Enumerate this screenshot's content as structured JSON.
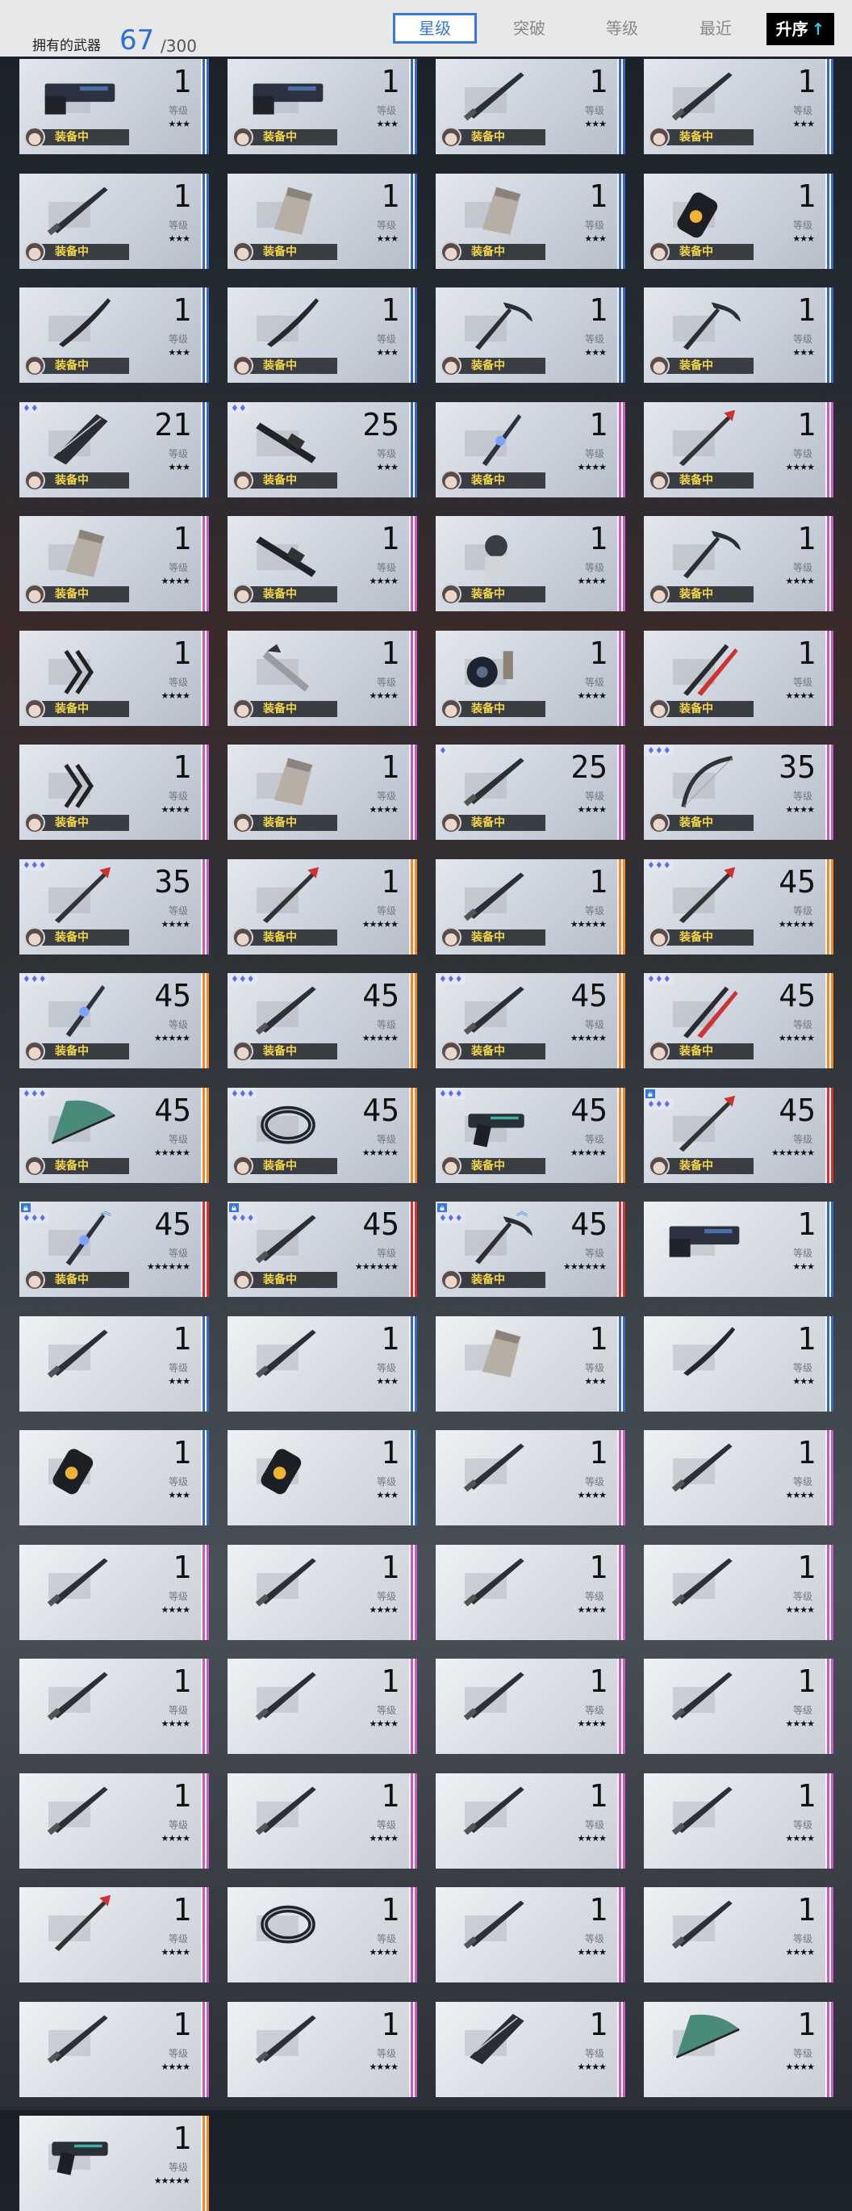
{
  "header": {
    "owned_label": "拥有的武器",
    "owned_count": "67",
    "owned_total": "/300",
    "tabs": [
      {
        "label": "星级",
        "active": true
      },
      {
        "label": "突破",
        "active": false
      },
      {
        "label": "等级",
        "active": false
      },
      {
        "label": "最近",
        "active": false
      }
    ],
    "sort_label": "升序",
    "sort_icon": "arrow-up-icon"
  },
  "common": {
    "level_label": "等级",
    "equipped_label": "装备中"
  },
  "colors": {
    "rarity_3": "#3c68b8",
    "rarity_4": "#c25ec0",
    "rarity_5": "#ee8a2a",
    "rarity_6": "#d83030",
    "accent": "#3a78d8",
    "equipped_text": "#f4d64a"
  },
  "weapons": [
    {
      "level": "1",
      "stars": "★★★",
      "rarity": 3,
      "equipped": true,
      "icon": "blaster-icon"
    },
    {
      "level": "1",
      "stars": "★★★",
      "rarity": 3,
      "equipped": true,
      "icon": "blaster-icon"
    },
    {
      "level": "1",
      "stars": "★★★",
      "rarity": 3,
      "equipped": true,
      "icon": "blade-icon"
    },
    {
      "level": "1",
      "stars": "★★★",
      "rarity": 3,
      "equipped": true,
      "icon": "blade-icon"
    },
    {
      "level": "1",
      "stars": "★★★",
      "rarity": 3,
      "equipped": true,
      "icon": "blade-icon"
    },
    {
      "level": "1",
      "stars": "★★★",
      "rarity": 3,
      "equipped": true,
      "icon": "gauntlet-icon"
    },
    {
      "level": "1",
      "stars": "★★★",
      "rarity": 3,
      "equipped": true,
      "icon": "gauntlet-icon"
    },
    {
      "level": "1",
      "stars": "★★★",
      "rarity": 3,
      "equipped": true,
      "icon": "cannon-icon"
    },
    {
      "level": "1",
      "stars": "★★★",
      "rarity": 3,
      "equipped": true,
      "icon": "katana-icon"
    },
    {
      "level": "1",
      "stars": "★★★",
      "rarity": 3,
      "equipped": true,
      "icon": "katana-icon"
    },
    {
      "level": "1",
      "stars": "★★★",
      "rarity": 3,
      "equipped": true,
      "icon": "scythe-icon"
    },
    {
      "level": "1",
      "stars": "★★★",
      "rarity": 3,
      "equipped": true,
      "icon": "scythe-icon"
    },
    {
      "level": "21",
      "stars": "★★★",
      "rarity": 3,
      "equipped": true,
      "icon": "greatsword-icon",
      "tier": "♦♦"
    },
    {
      "level": "25",
      "stars": "★★★",
      "rarity": 3,
      "equipped": true,
      "icon": "rifle-icon",
      "tier": "♦♦"
    },
    {
      "level": "1",
      "stars": "★★★★",
      "rarity": 4,
      "equipped": true,
      "icon": "lance-icon"
    },
    {
      "level": "1",
      "stars": "★★★★",
      "rarity": 4,
      "equipped": true,
      "icon": "spear-icon"
    },
    {
      "level": "1",
      "stars": "★★★★",
      "rarity": 4,
      "equipped": true,
      "icon": "gauntlet-icon"
    },
    {
      "level": "1",
      "stars": "★★★★",
      "rarity": 4,
      "equipped": true,
      "icon": "rifle-icon"
    },
    {
      "level": "1",
      "stars": "★★★★",
      "rarity": 4,
      "equipped": true,
      "icon": "mech-icon"
    },
    {
      "level": "1",
      "stars": "★★★★",
      "rarity": 4,
      "equipped": true,
      "icon": "scythe-icon"
    },
    {
      "level": "1",
      "stars": "★★★★",
      "rarity": 4,
      "equipped": true,
      "icon": "claw-icon"
    },
    {
      "level": "1",
      "stars": "★★★★",
      "rarity": 4,
      "equipped": true,
      "icon": "arm-blade-icon"
    },
    {
      "level": "1",
      "stars": "★★★★",
      "rarity": 4,
      "equipped": true,
      "icon": "disc-icon"
    },
    {
      "level": "1",
      "stars": "★★★★",
      "rarity": 4,
      "equipped": true,
      "icon": "dual-blade-icon"
    },
    {
      "level": "1",
      "stars": "★★★★",
      "rarity": 4,
      "equipped": true,
      "icon": "claw-icon"
    },
    {
      "level": "1",
      "stars": "★★★★",
      "rarity": 4,
      "equipped": true,
      "icon": "gauntlet-icon"
    },
    {
      "level": "25",
      "stars": "★★★★",
      "rarity": 4,
      "equipped": true,
      "icon": "blade-icon",
      "tier": "♦"
    },
    {
      "level": "35",
      "stars": "★★★★",
      "rarity": 4,
      "equipped": true,
      "icon": "bow-icon",
      "tier": "♦♦♦"
    },
    {
      "level": "35",
      "stars": "★★★★",
      "rarity": 4,
      "equipped": true,
      "icon": "spear-icon",
      "tier": "♦♦♦"
    },
    {
      "level": "1",
      "stars": "★★★★★",
      "rarity": 5,
      "equipped": true,
      "icon": "spear-icon"
    },
    {
      "level": "1",
      "stars": "★★★★★",
      "rarity": 5,
      "equipped": true,
      "icon": "blade-icon"
    },
    {
      "level": "45",
      "stars": "★★★★★",
      "rarity": 5,
      "equipped": true,
      "icon": "spear-icon",
      "tier": "♦♦♦"
    },
    {
      "level": "45",
      "stars": "★★★★★",
      "rarity": 5,
      "equipped": true,
      "icon": "lance-icon",
      "tier": "♦♦♦"
    },
    {
      "level": "45",
      "stars": "★★★★★",
      "rarity": 5,
      "equipped": true,
      "icon": "blade-icon",
      "tier": "♦♦♦"
    },
    {
      "level": "45",
      "stars": "★★★★★",
      "rarity": 5,
      "equipped": true,
      "icon": "blade-icon",
      "tier": "♦♦♦"
    },
    {
      "level": "45",
      "stars": "★★★★★",
      "rarity": 5,
      "equipped": true,
      "icon": "dual-blade-icon",
      "tier": "♦♦♦"
    },
    {
      "level": "45",
      "stars": "★★★★★",
      "rarity": 5,
      "equipped": true,
      "icon": "fan-icon",
      "tier": "♦♦♦"
    },
    {
      "level": "45",
      "stars": "★★★★★",
      "rarity": 5,
      "equipped": true,
      "icon": "ring-icon",
      "tier": "♦♦♦"
    },
    {
      "level": "45",
      "stars": "★★★★★",
      "rarity": 5,
      "equipped": true,
      "icon": "pistol-icon",
      "tier": "♦♦♦"
    },
    {
      "level": "45",
      "stars": "★★★★★★",
      "rarity": 6,
      "equipped": true,
      "icon": "spear-icon",
      "tier": "♦♦♦",
      "lock": true
    },
    {
      "level": "45",
      "stars": "★★★★★★",
      "rarity": 6,
      "equipped": true,
      "icon": "lance-icon",
      "tier": "♦♦♦",
      "lock": true,
      "up": true
    },
    {
      "level": "45",
      "stars": "★★★★★★",
      "rarity": 6,
      "equipped": true,
      "icon": "blade-icon",
      "tier": "♦♦♦",
      "lock": true
    },
    {
      "level": "45",
      "stars": "★★★★★★",
      "rarity": 6,
      "equipped": true,
      "icon": "scythe-icon",
      "tier": "♦♦♦",
      "lock": true,
      "up": true
    },
    {
      "level": "1",
      "stars": "★★★",
      "rarity": 3,
      "equipped": false,
      "icon": "blaster-icon"
    },
    {
      "level": "1",
      "stars": "★★★",
      "rarity": 3,
      "equipped": false,
      "icon": "blade-icon"
    },
    {
      "level": "1",
      "stars": "★★★",
      "rarity": 3,
      "equipped": false,
      "icon": "blade-icon"
    },
    {
      "level": "1",
      "stars": "★★★",
      "rarity": 3,
      "equipped": false,
      "icon": "gauntlet-icon"
    },
    {
      "level": "1",
      "stars": "★★★",
      "rarity": 3,
      "equipped": false,
      "icon": "katana-icon"
    },
    {
      "level": "1",
      "stars": "★★★",
      "rarity": 3,
      "equipped": false,
      "icon": "cannon-icon"
    },
    {
      "level": "1",
      "stars": "★★★",
      "rarity": 3,
      "equipped": false,
      "icon": "cannon-icon"
    },
    {
      "level": "1",
      "stars": "★★★★",
      "rarity": 4,
      "equipped": false,
      "icon": "blade-icon"
    },
    {
      "level": "1",
      "stars": "★★★★",
      "rarity": 4,
      "equipped": false,
      "icon": "blade-icon"
    },
    {
      "level": "1",
      "stars": "★★★★",
      "rarity": 4,
      "equipped": false,
      "icon": "blade-icon"
    },
    {
      "level": "1",
      "stars": "★★★★",
      "rarity": 4,
      "equipped": false,
      "icon": "blade-icon"
    },
    {
      "level": "1",
      "stars": "★★★★",
      "rarity": 4,
      "equipped": false,
      "icon": "blade-icon"
    },
    {
      "level": "1",
      "stars": "★★★★",
      "rarity": 4,
      "equipped": false,
      "icon": "blade-icon"
    },
    {
      "level": "1",
      "stars": "★★★★",
      "rarity": 4,
      "equipped": false,
      "icon": "blade-icon"
    },
    {
      "level": "1",
      "stars": "★★★★",
      "rarity": 4,
      "equipped": false,
      "icon": "blade-icon"
    },
    {
      "level": "1",
      "stars": "★★★★",
      "rarity": 4,
      "equipped": false,
      "icon": "blade-icon"
    },
    {
      "level": "1",
      "stars": "★★★★",
      "rarity": 4,
      "equipped": false,
      "icon": "blade-icon"
    },
    {
      "level": "1",
      "stars": "★★★★",
      "rarity": 4,
      "equipped": false,
      "icon": "blade-icon"
    },
    {
      "level": "1",
      "stars": "★★★★",
      "rarity": 4,
      "equipped": false,
      "icon": "blade-icon"
    },
    {
      "level": "1",
      "stars": "★★★★",
      "rarity": 4,
      "equipped": false,
      "icon": "blade-icon"
    },
    {
      "level": "1",
      "stars": "★★★★",
      "rarity": 4,
      "equipped": false,
      "icon": "blade-icon"
    },
    {
      "level": "1",
      "stars": "★★★★",
      "rarity": 4,
      "equipped": false,
      "icon": "spear-icon"
    },
    {
      "level": "1",
      "stars": "★★★★",
      "rarity": 4,
      "equipped": false,
      "icon": "ring-icon"
    },
    {
      "level": "1",
      "stars": "★★★★",
      "rarity": 4,
      "equipped": false,
      "icon": "blade-icon"
    },
    {
      "level": "1",
      "stars": "★★★★",
      "rarity": 4,
      "equipped": false,
      "icon": "blade-icon"
    },
    {
      "level": "1",
      "stars": "★★★★",
      "rarity": 4,
      "equipped": false,
      "icon": "blade-icon"
    },
    {
      "level": "1",
      "stars": "★★★★",
      "rarity": 4,
      "equipped": false,
      "icon": "blade-icon"
    },
    {
      "level": "1",
      "stars": "★★★★",
      "rarity": 4,
      "equipped": false,
      "icon": "greatsword-icon"
    },
    {
      "level": "1",
      "stars": "★★★★",
      "rarity": 4,
      "equipped": false,
      "icon": "fan-icon"
    },
    {
      "level": "1",
      "stars": "★★★★★",
      "rarity": 5,
      "equipped": false,
      "icon": "pistol-icon"
    }
  ]
}
